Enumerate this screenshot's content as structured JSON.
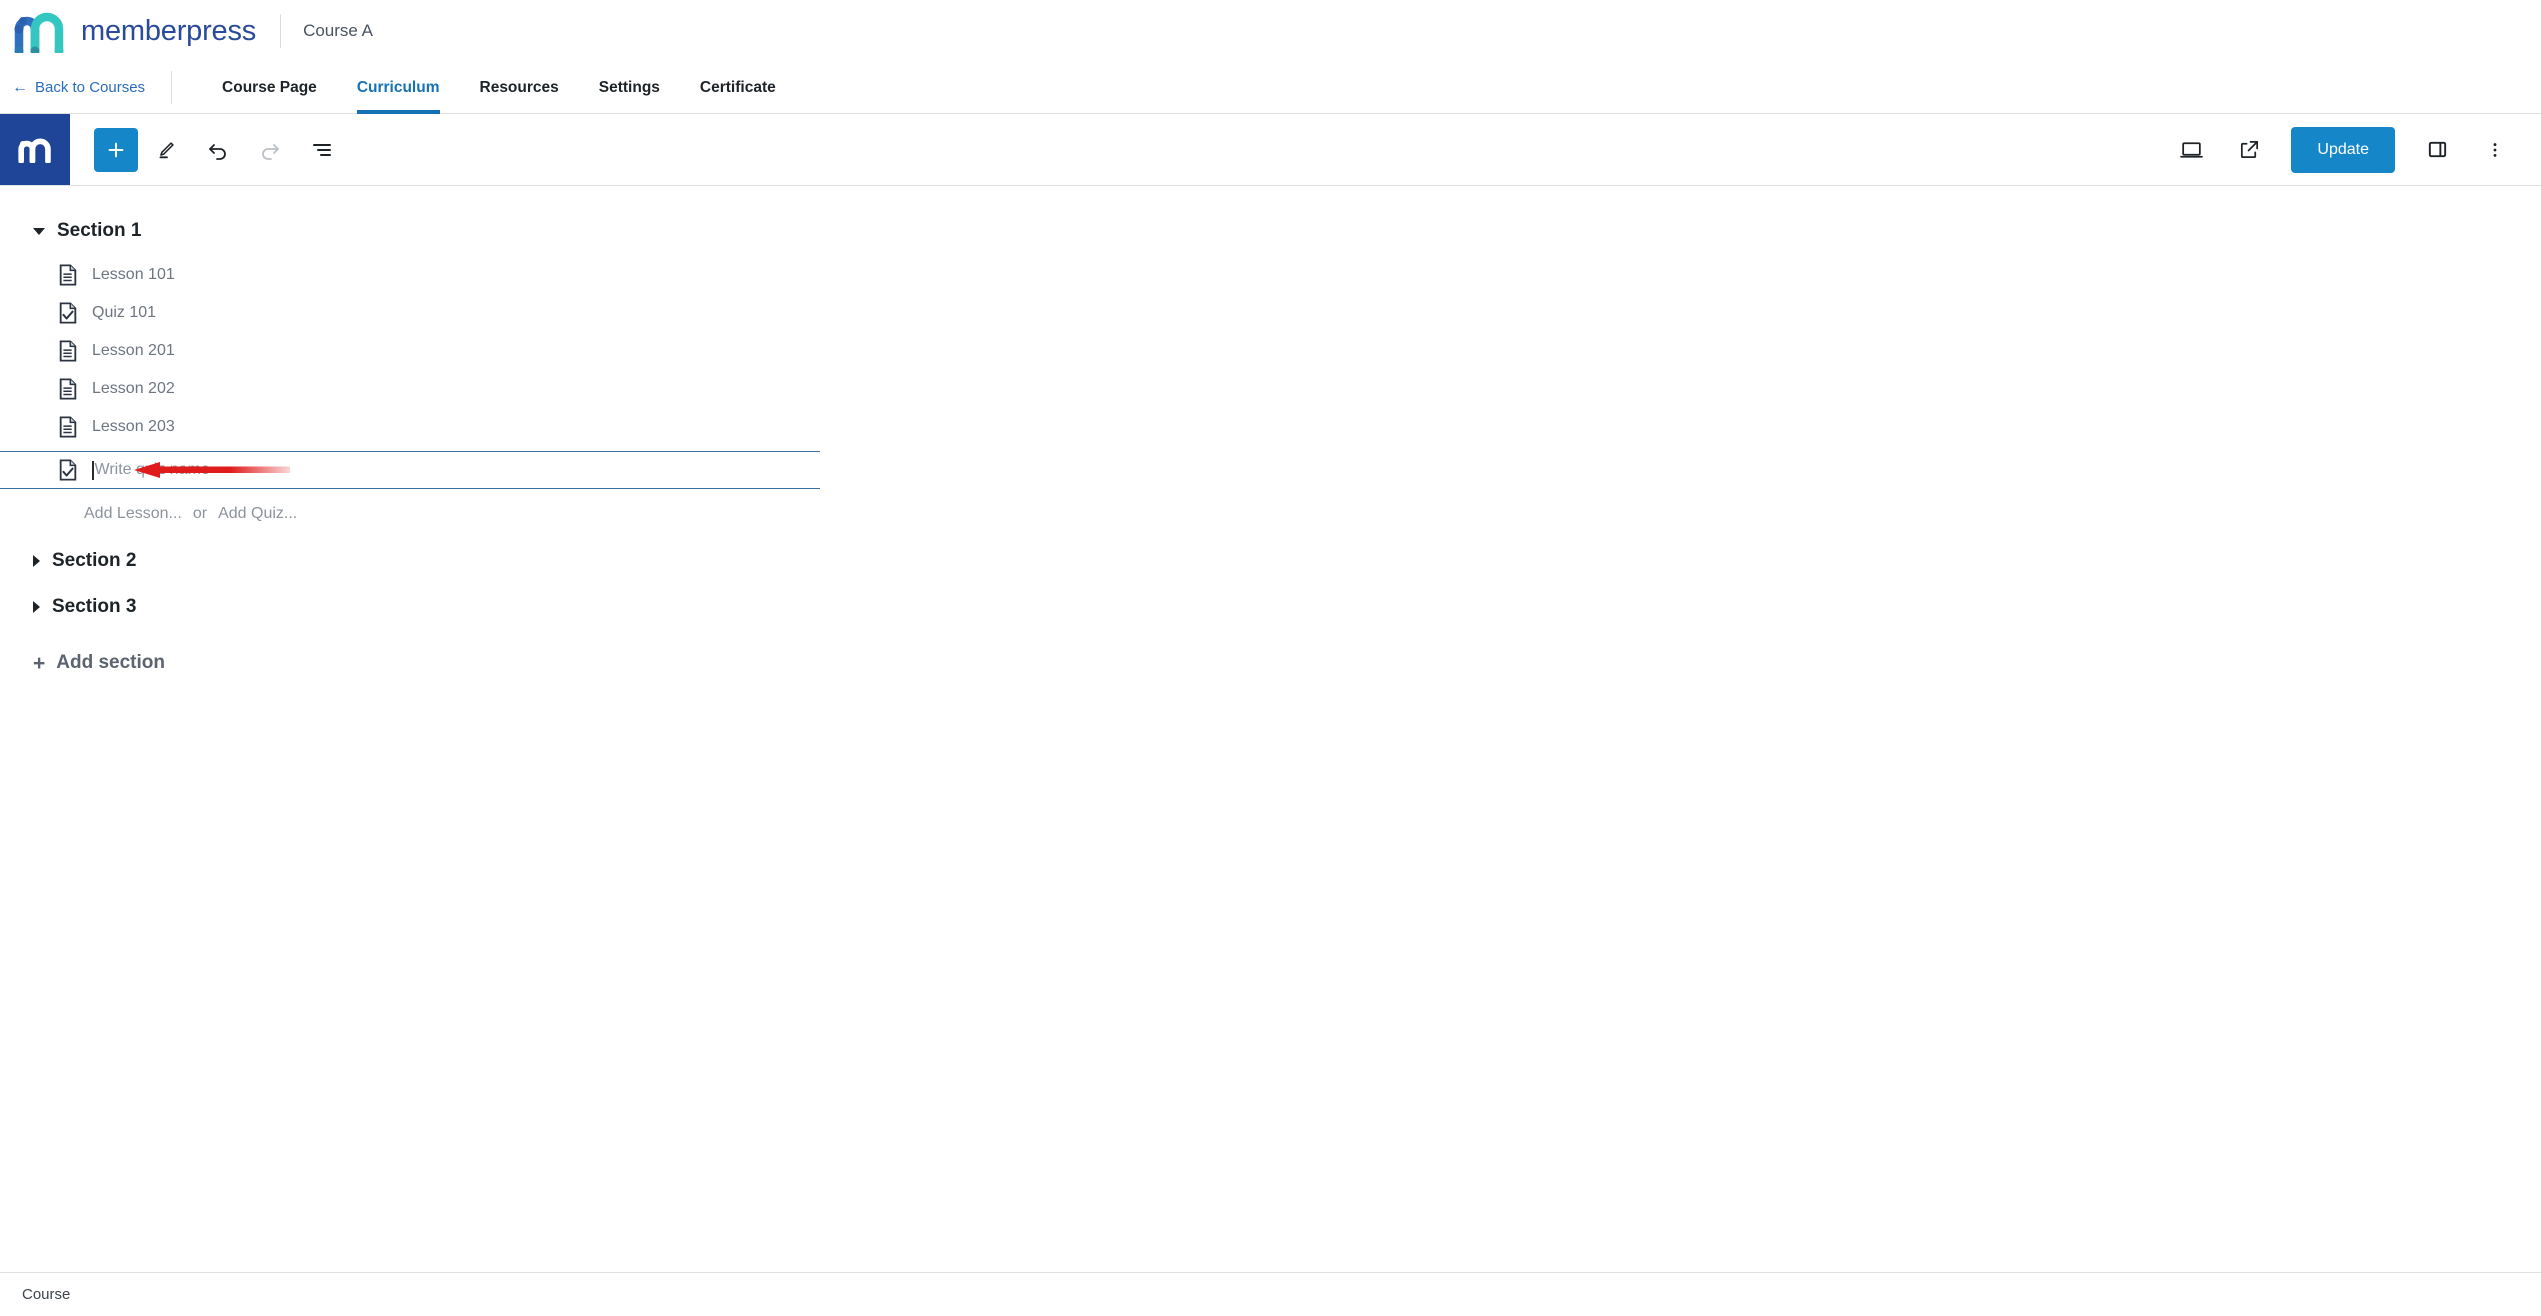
{
  "brand": {
    "name": "memberpress",
    "logo_icon": "memberpress-m-logo",
    "course_name": "Course A",
    "colors": {
      "wordmark": "#2a4b9b",
      "logo_blue": "#2d62b4",
      "logo_teal": "#2ec4c0"
    }
  },
  "nav": {
    "back_label": "Back to Courses",
    "back_icon": "arrow-left-icon",
    "tabs": [
      {
        "label": "Course Page",
        "active": false
      },
      {
        "label": "Curriculum",
        "active": true
      },
      {
        "label": "Resources",
        "active": false
      },
      {
        "label": "Settings",
        "active": false
      },
      {
        "label": "Certificate",
        "active": false
      }
    ],
    "active_color": "#1573b5"
  },
  "editor_toolbar": {
    "logo_icon": "memberpress-m-icon",
    "left_tools": [
      {
        "name": "add-block-button",
        "icon": "plus-icon",
        "label": "Add block",
        "primary": true,
        "disabled": false
      },
      {
        "name": "edit-tool-button",
        "icon": "pencil-icon",
        "label": "Tools",
        "primary": false,
        "disabled": false
      },
      {
        "name": "undo-button",
        "icon": "undo-arrow-icon",
        "label": "Undo",
        "primary": false,
        "disabled": false
      },
      {
        "name": "redo-button",
        "icon": "redo-arrow-icon",
        "label": "Redo",
        "primary": false,
        "disabled": true
      },
      {
        "name": "details-button",
        "icon": "list-view-icon",
        "label": "Details",
        "primary": false,
        "disabled": false
      }
    ],
    "right_tools": [
      {
        "name": "preview-button",
        "icon": "desktop-icon",
        "label": "Preview"
      },
      {
        "name": "view-post-button",
        "icon": "external-link-icon",
        "label": "View"
      }
    ],
    "update_label": "Update",
    "update_color": "#1587c8",
    "settings_sidebar_icon": "sidebar-panel-icon",
    "more_options_icon": "three-dots-vertical-icon"
  },
  "curriculum": {
    "sections": [
      {
        "title": "Section 1",
        "expanded": true,
        "items": [
          {
            "label": "Lesson 101",
            "type": "lesson"
          },
          {
            "label": "Quiz 101",
            "type": "quiz"
          },
          {
            "label": "Lesson 201",
            "type": "lesson"
          },
          {
            "label": "Lesson 202",
            "type": "lesson"
          },
          {
            "label": "Lesson 203",
            "type": "lesson"
          }
        ],
        "new_quiz_input": {
          "placeholder": "Write quiz name",
          "value": "",
          "icon": "quiz-document-icon",
          "focused": true
        },
        "add_lesson_label": "Add Lesson...",
        "or_label": "or",
        "add_quiz_label": "Add Quiz..."
      },
      {
        "title": "Section 2",
        "expanded": false,
        "items": []
      },
      {
        "title": "Section 3",
        "expanded": false,
        "items": []
      }
    ],
    "add_section_label": "Add section",
    "add_section_icon": "plus-icon"
  },
  "annotation": {
    "type": "red-arrow-left",
    "color": "#e01b1b",
    "points_to": "Write quiz name"
  },
  "status_bar": {
    "label": "Course"
  }
}
